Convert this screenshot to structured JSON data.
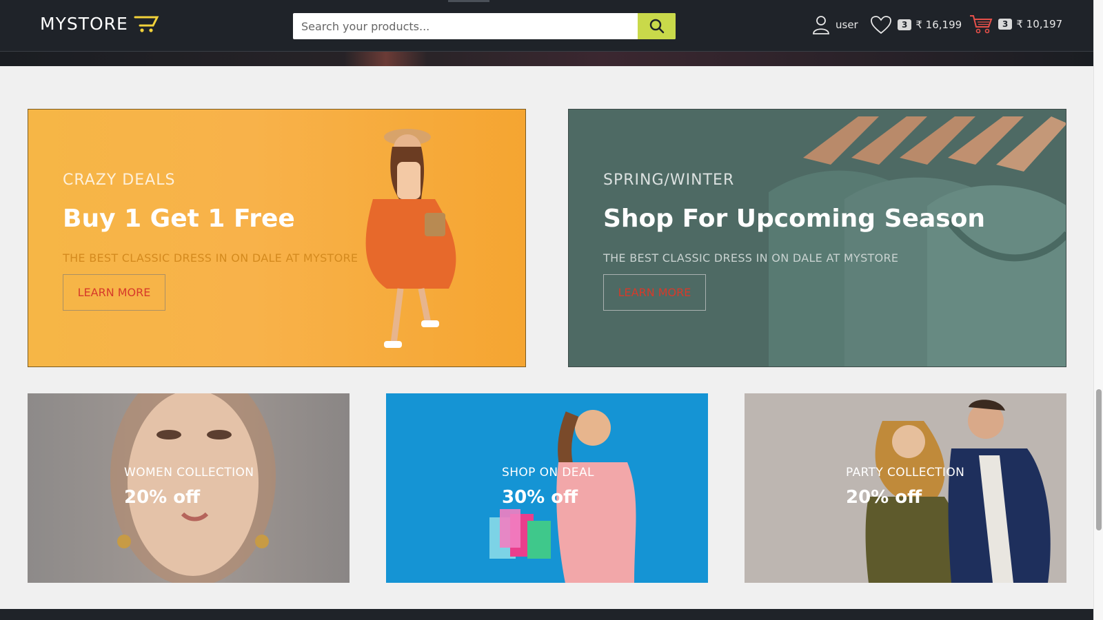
{
  "header": {
    "logo": "MYSTORE",
    "search_placeholder": "Search your products...",
    "user_label": "user",
    "wishlist_count": "3",
    "wishlist_total": "₹ 16,199",
    "cart_count": "3",
    "cart_total": "₹ 10,197"
  },
  "banners": [
    {
      "eyebrow": "CRAZY DEALS",
      "title": "Buy 1 Get 1 Free",
      "subtitle": "THE BEST CLASSIC DRESS IN ON DALE AT MYSTORE",
      "button": "LEARN MORE"
    },
    {
      "eyebrow": "SPRING/WINTER",
      "title": "Shop For Upcoming Season",
      "subtitle": "THE BEST CLASSIC DRESS IN ON DALE AT MYSTORE",
      "button": "LEARN MORE"
    }
  ],
  "promos": [
    {
      "label": "WOMEN COLLECTION",
      "discount": "20% off"
    },
    {
      "label": "SHOP ON DEAL",
      "discount": "30% off"
    },
    {
      "label": "PARTY COLLECTION",
      "discount": "20% off"
    }
  ],
  "colors": {
    "header_bg": "#1f2329",
    "search_button": "#c9d94a",
    "learn_more_text": "#d63a2a",
    "banner_1_bg": "#f6b646",
    "banner_2_bg": "#4e6a64",
    "promo_2_bg": "#1594d4"
  },
  "icons": {
    "logo": "cart-icon",
    "search": "search-icon",
    "user": "user-icon",
    "wishlist": "heart-icon",
    "cart": "cart-icon"
  }
}
